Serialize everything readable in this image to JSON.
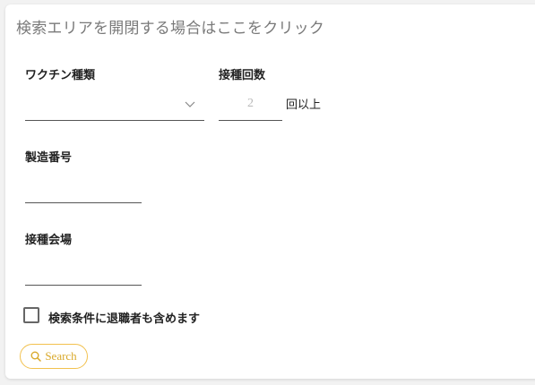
{
  "search_panel": {
    "toggle_text": "検索エリアを開閉する場合はここをクリック",
    "vaccine_type": {
      "label": "ワクチン種類",
      "value": ""
    },
    "dose_count": {
      "label": "接種回数",
      "placeholder": "2",
      "suffix": "回以上"
    },
    "lot_number": {
      "label": "製造番号",
      "value": ""
    },
    "venue": {
      "label": "接種会場",
      "value": ""
    },
    "include_retired": {
      "label": "検索条件に退職者も含めます",
      "checked": false
    },
    "search_button": {
      "label": "Search",
      "icon": "search-icon"
    }
  },
  "colors": {
    "accent": "#f2c14e",
    "accent_text": "#d9a92b",
    "header_text": "#7a7a7a",
    "placeholder_text": "#b9b9b9"
  }
}
